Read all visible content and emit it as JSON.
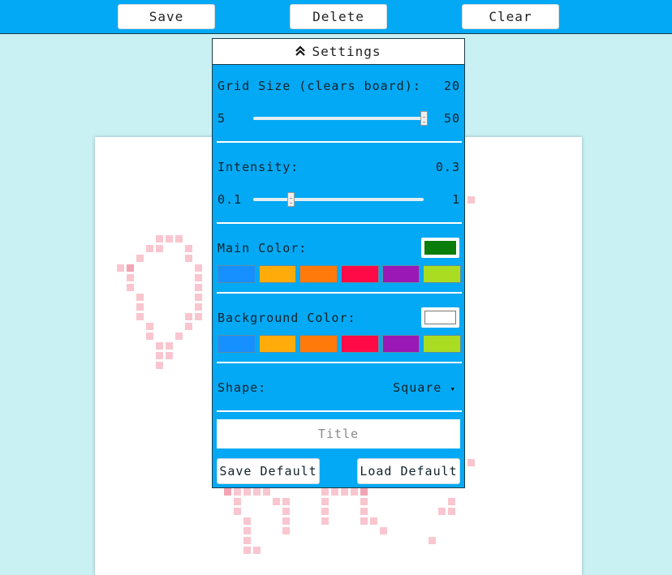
{
  "toolbar": {
    "save_label": "Save",
    "delete_label": "Delete",
    "clear_label": "Clear"
  },
  "settings": {
    "header_label": "Settings",
    "header_icon": "chevron-double-up-icon",
    "grid_size": {
      "label": "Grid Size (clears board):",
      "value": "20",
      "min": "5",
      "max": "50",
      "slider_fraction": 1.0
    },
    "intensity": {
      "label": "Intensity:",
      "value": "0.3",
      "min": "0.1",
      "max": "1",
      "slider_fraction": 0.22
    },
    "main_color": {
      "label": "Main Color:",
      "current": "#0a7d0a"
    },
    "background_color": {
      "label": "Background Color:",
      "current": "#ffffff"
    },
    "palette": [
      "#168fff",
      "#ffab0a",
      "#ff7a0a",
      "#ff0a46",
      "#9a18b5",
      "#aadd22"
    ],
    "shape": {
      "label": "Shape:",
      "value": "Square"
    },
    "title_input": {
      "placeholder": "Title",
      "value": ""
    },
    "save_default_label": "Save Default",
    "load_default_label": "Load Default"
  }
}
